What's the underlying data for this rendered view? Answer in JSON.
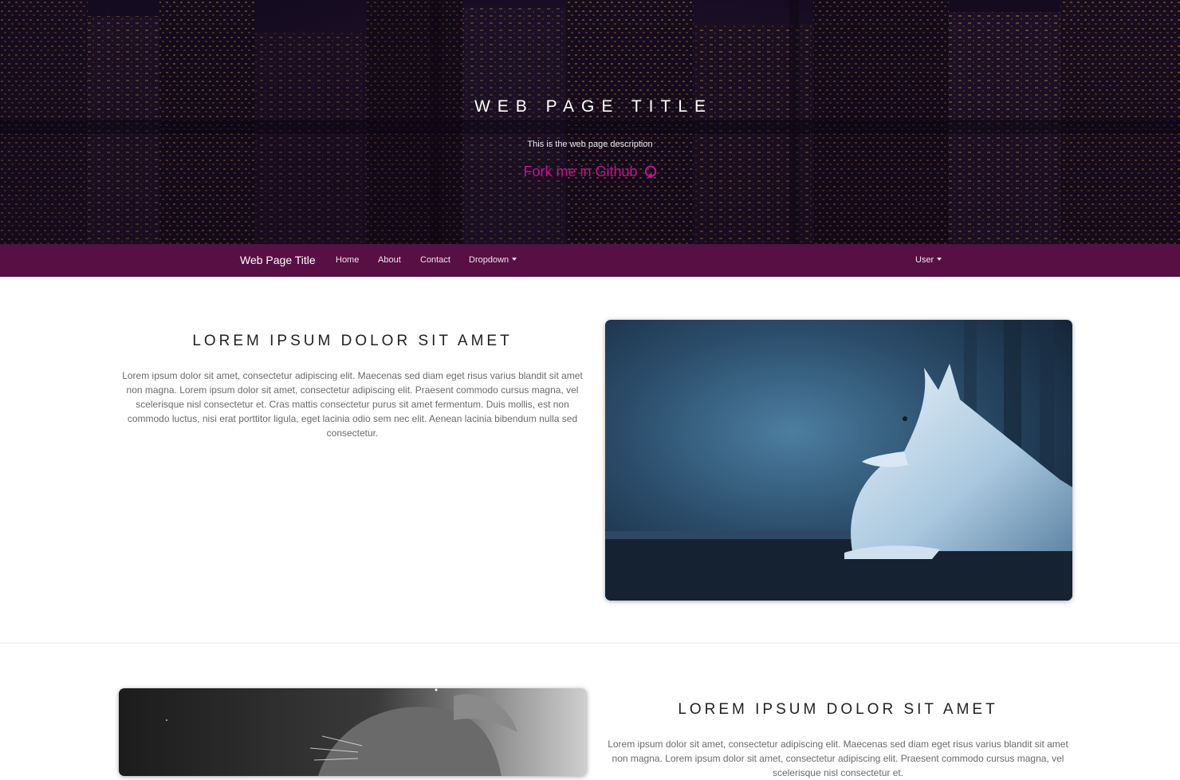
{
  "hero": {
    "title": "WEB PAGE TITLE",
    "description": "This is the web page description",
    "github_link": "Fork me in Github",
    "github_icon": "github-icon",
    "link_color": "#c01588"
  },
  "navbar": {
    "brand": "Web Page Title",
    "items": [
      "Home",
      "About",
      "Contact"
    ],
    "dropdown_label": "Dropdown",
    "user_label": "User",
    "background": "#570f44"
  },
  "sections": [
    {
      "heading": "LOREM IPSUM DOLOR SIT AMET",
      "text": "Lorem ipsum dolor sit amet, consectetur adipiscing elit. Maecenas sed diam eget risus varius blandit sit amet non magna. Lorem ipsum dolor sit amet, consectetur adipiscing elit. Praesent commodo cursus magna, vel scelerisque nisl consectetur et. Cras mattis consectetur purus sit amet fermentum. Duis mollis, est non commodo luctus, nisi erat porttitor ligula, eget lacinia odio sem nec elit. Aenean lacinia bibendum nulla sed consectetur.",
      "image": "white-wolf-photo"
    },
    {
      "heading": "LOREM IPSUM DOLOR SIT AMET",
      "text": "Lorem ipsum dolor sit amet, consectetur adipiscing elit. Maecenas sed diam eget risus varius blandit sit amet non magna. Lorem ipsum dolor sit amet, consectetur adipiscing elit. Praesent commodo cursus magna, vel scelerisque nisl consectetur et.",
      "image": "lion-cub-photo"
    }
  ]
}
